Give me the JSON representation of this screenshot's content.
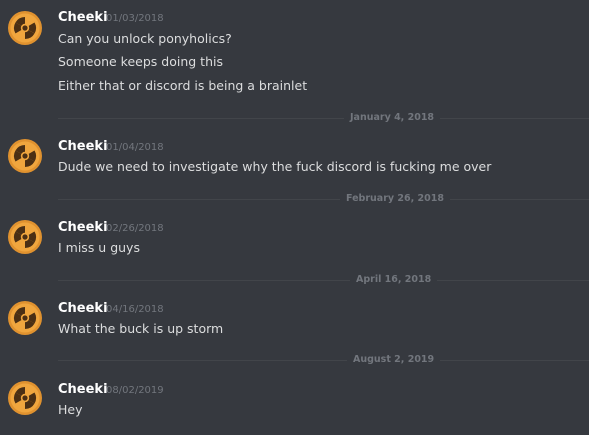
{
  "messages": [
    {
      "username": "Cheeki",
      "timestamp": "01/03/2018",
      "avatar_icon": "radiation-icon",
      "lines": [
        "Can you unlock ponyholics?",
        "Someone keeps doing this",
        "Either that or discord is being a brainlet"
      ]
    },
    {
      "divider": "January 4, 2018",
      "username": "Cheeki",
      "timestamp": "01/04/2018",
      "avatar_icon": "radiation-icon",
      "lines": [
        "Dude we need to investigate why the fuck discord is fucking me over"
      ]
    },
    {
      "divider": "February 26, 2018",
      "username": "Cheeki",
      "timestamp": "02/26/2018",
      "avatar_icon": "radiation-icon",
      "lines": [
        "I miss u guys"
      ]
    },
    {
      "divider": "April 16, 2018",
      "username": "Cheeki",
      "timestamp": "04/16/2018",
      "avatar_icon": "radiation-icon",
      "lines": [
        "What the buck is up storm"
      ]
    },
    {
      "divider": "August 2, 2019",
      "username": "Cheeki",
      "timestamp": "08/02/2019",
      "avatar_icon": "radiation-icon",
      "lines": [
        "Hey"
      ]
    }
  ],
  "colors": {
    "background": "#36393f",
    "username": "#ffffff",
    "message_text": "#dcddde",
    "timestamp": "#72767d",
    "divider_line": "#42454a",
    "avatar_orange": "#e0922f",
    "avatar_dark": "#4a2f14"
  }
}
